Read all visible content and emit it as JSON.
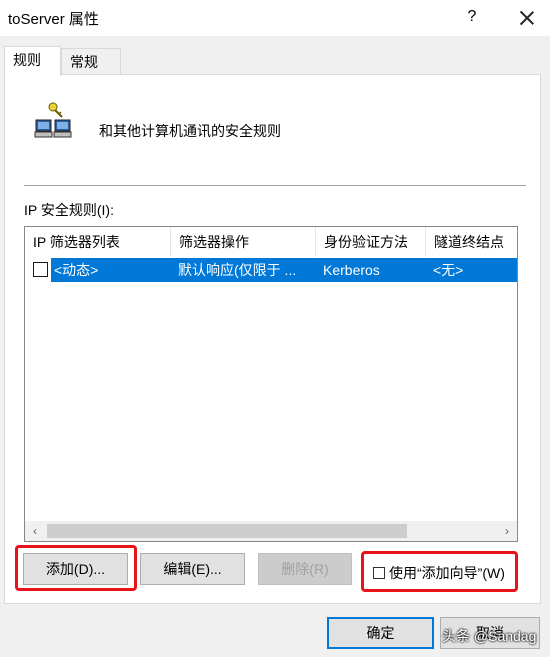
{
  "window": {
    "title": "toServer 属性",
    "help_label": "?"
  },
  "tabs": [
    {
      "label": "规则"
    },
    {
      "label": "常规"
    }
  ],
  "rules_page": {
    "description": "和其他计算机通讯的安全规则",
    "list_label": "IP 安全规则(I):",
    "columns": [
      "IP 筛选器列表",
      "筛选器操作",
      "身份验证方法",
      "隧道终结点"
    ],
    "rows": [
      {
        "checked": false,
        "filter_list": "<动态>",
        "filter_action": "默认响应(仅限于 ...",
        "auth_method": "Kerberos",
        "tunnel_endpoint": "<无>"
      }
    ],
    "scroll_left": "‹",
    "scroll_right": "›"
  },
  "buttons": {
    "add": "添加(D)...",
    "edit": "编辑(E)...",
    "remove": "删除(R)",
    "use_wizard": "使用“添加向导”(W)",
    "ok": "确定",
    "cancel": "取消"
  },
  "watermark": "头条 @Sandag",
  "colors": {
    "selection": "#0078d7",
    "highlight": "#e8141a",
    "background": "#f0f0f0"
  }
}
